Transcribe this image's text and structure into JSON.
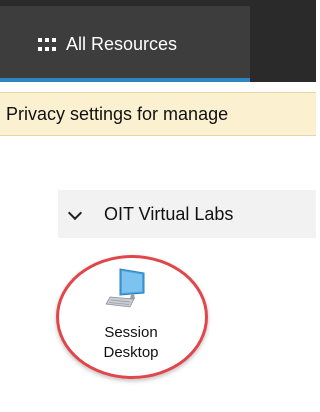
{
  "header": {
    "tab_label": "All Resources",
    "tab_icon": "apps-grid-icon"
  },
  "notice": {
    "text": "Privacy settings for manage"
  },
  "group": {
    "label": "OIT Virtual Labs",
    "expand_icon": "chevron-down-icon"
  },
  "resource": {
    "label_line1": "Session",
    "label_line2": "Desktop",
    "icon": "desktop-computer-icon"
  },
  "colors": {
    "tab_accent": "#2e86c1",
    "highlight_ring": "#e0464a",
    "notice_bg": "#fbf1d1"
  }
}
